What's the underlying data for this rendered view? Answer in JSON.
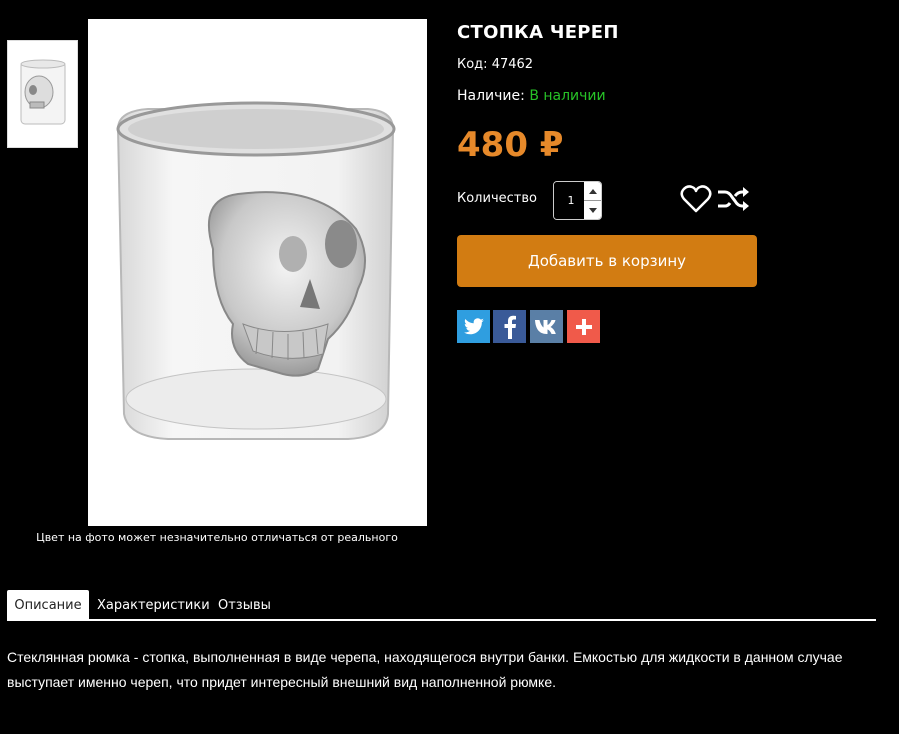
{
  "product": {
    "title": "СТОПКА ЧЕРЕП",
    "code_label": "Код:",
    "code_value": "47462",
    "availability_label": "Наличие:",
    "availability_value": "В наличии",
    "price": "480 ₽",
    "quantity_label": "Количество",
    "quantity_value": "1",
    "add_to_cart_label": "Добавить в корзину",
    "photo_note": "Цвет на фото может незначительно отличаться от реального"
  },
  "icons": {
    "wishlist": "heart-icon",
    "compare": "shuffle-icon",
    "share": [
      "twitter-icon",
      "facebook-icon",
      "vk-icon",
      "plus-icon"
    ]
  },
  "tabs": [
    {
      "label": "Описание",
      "active": true
    },
    {
      "label": "Характеристики",
      "active": false
    },
    {
      "label": "Отзывы",
      "active": false
    }
  ],
  "description": "Стеклянная рюмка - стопка, выполненная в виде черепа, находящегося внутри банки. Емкостью для жидкости в данном случае выступает именно череп, что придет интересный внешний вид наполненной рюмке.",
  "colors": {
    "price": "#e6892a",
    "availability": "#27c227",
    "cart_button": "#d27c12",
    "twitter": "#2f9ee0",
    "facebook": "#3a5a98",
    "vk": "#5a7fa6",
    "more": "#f05a4a"
  }
}
